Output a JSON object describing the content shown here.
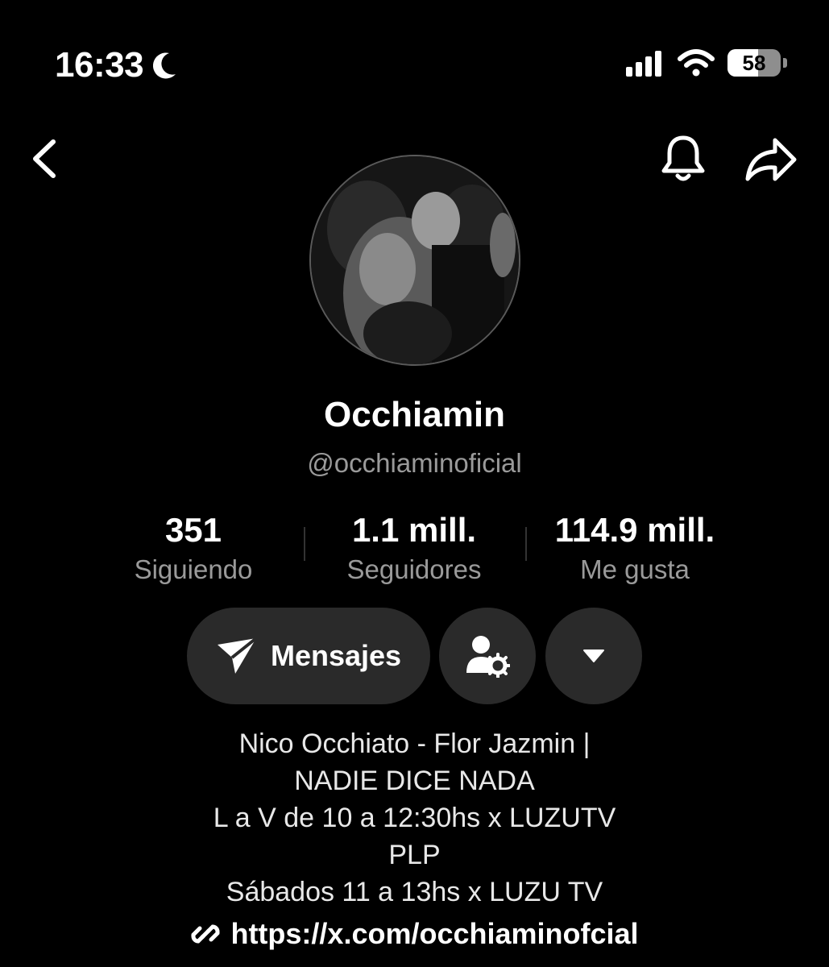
{
  "status_bar": {
    "time": "16:33",
    "battery": "58",
    "battery_level": 0.58
  },
  "nav": {
    "back_icon": "chevron-left-icon",
    "bell_icon": "bell-icon",
    "share_icon": "share-arrow-icon"
  },
  "profile": {
    "name": "Occhiamin",
    "handle": "@occhiaminoficial"
  },
  "stats": [
    {
      "value": "351",
      "label": "Siguiendo"
    },
    {
      "value": "1.1 mill.",
      "label": "Seguidores"
    },
    {
      "value": "114.9 mill.",
      "label": "Me gusta"
    }
  ],
  "actions": {
    "message_label": "Mensajes",
    "manage_icon": "user-settings-icon",
    "more_icon": "caret-down-icon"
  },
  "bio": {
    "lines": [
      "Nico Occhiato - Flor Jazmin |",
      "NADIE DICE NADA",
      "L a V de 10 a 12:30hs x LUZUTV",
      "PLP",
      "Sábados 11 a 13hs x LUZU TV"
    ],
    "link": "https://x.com/occhiaminofcial"
  },
  "colors": {
    "background": "#000000",
    "button_bg": "#2a2a2a",
    "secondary_text": "#9a9a9a"
  }
}
